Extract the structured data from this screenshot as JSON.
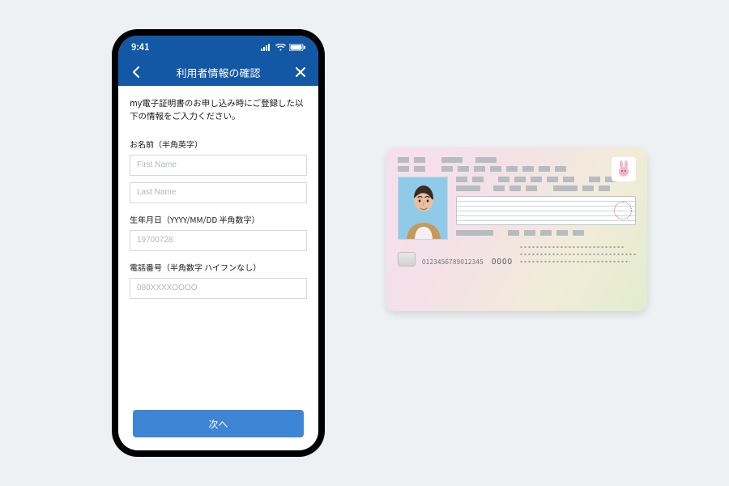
{
  "phone": {
    "status_time": "9:41",
    "nav_title": "利用者情報の確認",
    "instruction": "my電子証明書のお申し込み時にご登録した以下の情報をご入力ください。",
    "name_label": "お名前（半角英字）",
    "first_name_placeholder": "First Name",
    "last_name_placeholder": "Last Name",
    "dob_label": "生年月日（YYYY/MM/DD 半角数字）",
    "dob_placeholder": "19700728",
    "phone_label": "電話番号（半角数字 ハイフンなし）",
    "phone_placeholder": "080XXXXOOOO",
    "next_button": "次へ"
  },
  "card": {
    "serial": "0123456789012345",
    "zeros": "0000"
  }
}
